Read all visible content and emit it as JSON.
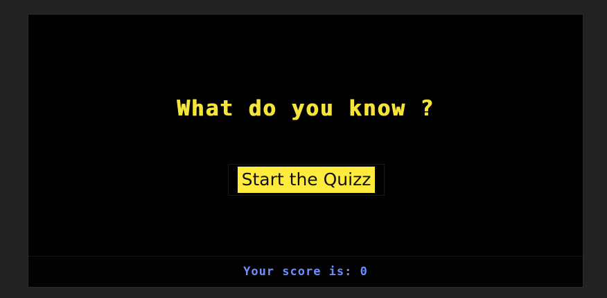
{
  "quiz": {
    "title": "What do you know ?",
    "start_label": "Start the Quizz"
  },
  "score": {
    "label": "Your score is:",
    "value": "0"
  },
  "colors": {
    "title": "#f5e43a",
    "button_bg": "#ffeb3b",
    "score_text": "#6d8dff",
    "background": "#000000",
    "page": "#222222"
  }
}
